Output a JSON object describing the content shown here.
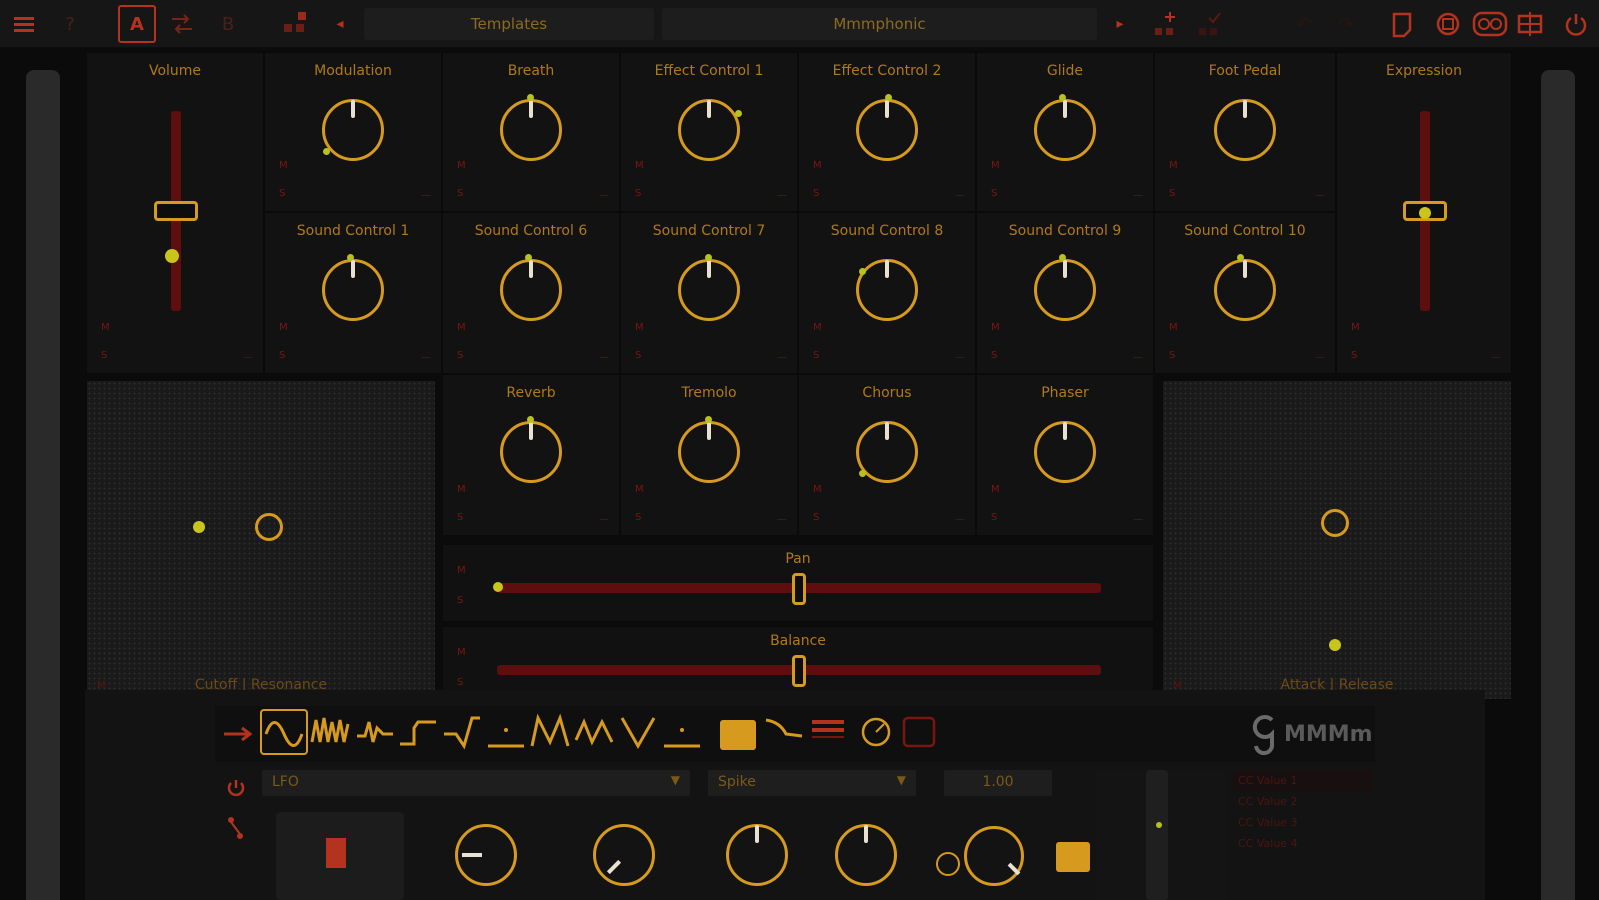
{
  "header": {
    "template_label": "Templates",
    "preset_name": "Mmmphonic",
    "icons": [
      "menu-icon",
      "help-icon",
      "layer-a-icon",
      "routing-icon",
      "layer-b-icon",
      "grid-icon",
      "prev-arrow-icon",
      "next-arrow-icon",
      "add-icon",
      "check-icon",
      "undo-icon",
      "redo-icon",
      "device-icon-1",
      "device-icon-2",
      "device-icon-3",
      "split-icon",
      "power-icon"
    ],
    "layer_a": "A",
    "layer_b": "B",
    "help": "?"
  },
  "colors": {
    "accent": "#d69a1f",
    "track": "#5e0e0e",
    "indicator": "#b7c21f",
    "background": "#0b0b0b"
  },
  "controls": {
    "m": "M",
    "s": "S",
    "volume": {
      "label": "Volume",
      "value": 0.5
    },
    "expression": {
      "label": "Expression",
      "value": 0.5
    },
    "knobs_row1": [
      "Modulation",
      "Breath",
      "Effect Control 1",
      "Effect Control 2",
      "Glide",
      "Foot Pedal"
    ],
    "knobs_row2": [
      "Sound Control 1",
      "Sound Control 6",
      "Sound Control 7",
      "Sound Control 8",
      "Sound Control 9",
      "Sound Control 10"
    ],
    "knobs_row3": [
      "Reverb",
      "Tremolo",
      "Chorus",
      "Phaser"
    ],
    "pan": {
      "label": "Pan",
      "value": 0.5
    },
    "balance": {
      "label": "Balance",
      "value": 0.5
    },
    "pad_left": {
      "label": "Cutoff | Resonance"
    },
    "pad_right": {
      "label": "Attack | Release"
    }
  },
  "lfo": {
    "source": "LFO",
    "shape": "Spike",
    "rate": "1.00",
    "brand": "MMMm",
    "side_items": [
      "CC Value 1",
      "CC Value 2",
      "CC Value 3",
      "CC Value 4"
    ],
    "icons": [
      "power-icon",
      "route-icon",
      "sine-wave-icon",
      "noise-wave-icon",
      "pulse-wave-icon",
      "step-wave-icon",
      "ramp-wave-icon",
      "flat-wave-icon",
      "m-wave-icon",
      "triangle-wave-icon",
      "v-wave-icon",
      "dot-wave-icon",
      "square-icon",
      "curve-icon",
      "bars-icon",
      "circle-icon",
      "rect-icon"
    ]
  }
}
